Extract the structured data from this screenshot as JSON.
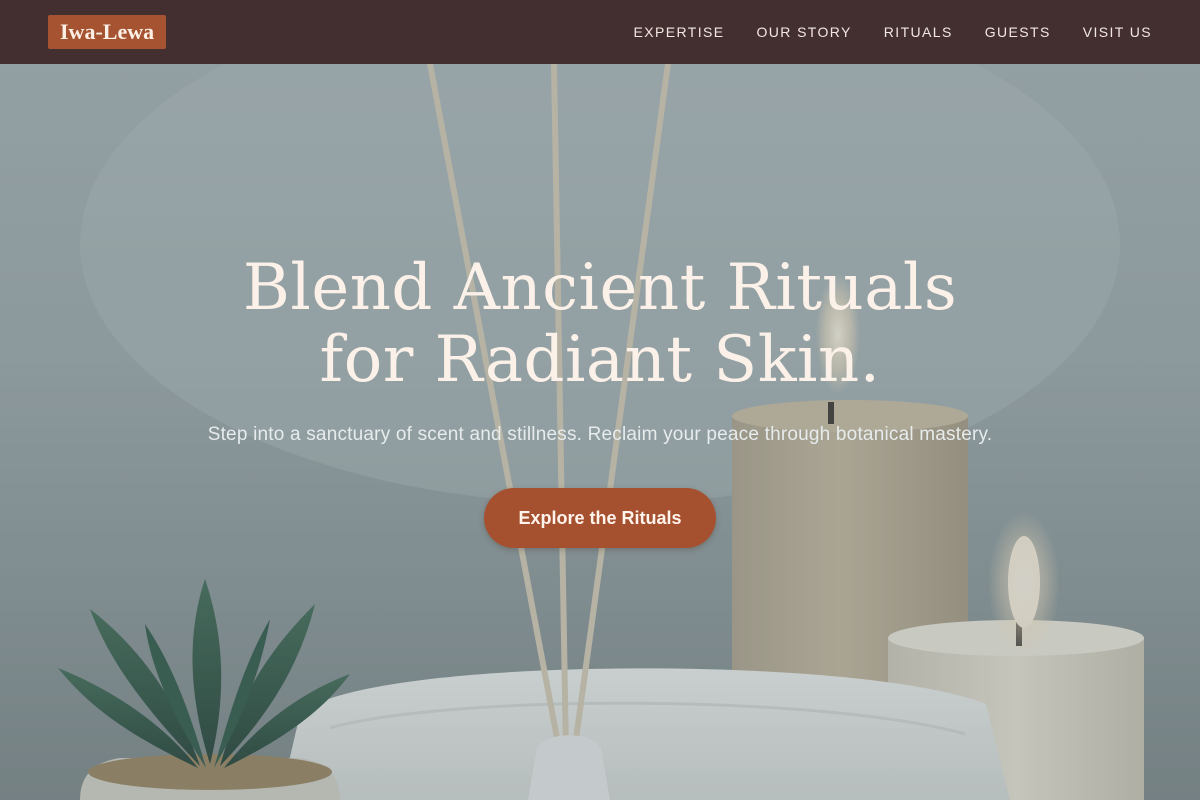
{
  "brand": {
    "name": "Iwa-Lewa"
  },
  "nav": {
    "items": [
      {
        "label": "EXPERTISE"
      },
      {
        "label": "OUR STORY"
      },
      {
        "label": "RITUALS"
      },
      {
        "label": "GUESTS"
      },
      {
        "label": "VISIT US"
      }
    ]
  },
  "hero": {
    "title_line1": "Blend Ancient Rituals",
    "title_line2": "for Radiant Skin.",
    "subtitle": "Step into a sanctuary of scent and stillness. Reclaim your peace through botanical mastery.",
    "cta_label": "Explore the Rituals"
  },
  "colors": {
    "nav_background": "#442f30",
    "brand_accent": "#a55330",
    "cta_background": "#a5512f",
    "hero_text": "#fbf1e8"
  },
  "icons": {
    "plant": "succulent-plant-illustration",
    "candles": "candle-illustration",
    "diffuser": "reed-diffuser-illustration",
    "towel": "folded-towel-illustration"
  }
}
